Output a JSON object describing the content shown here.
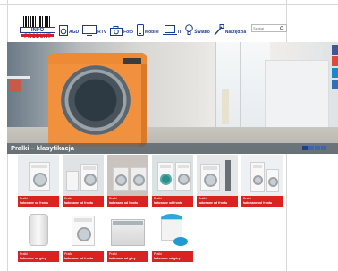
{
  "header": {
    "logo_text": "INFO PRODUKT",
    "nav": [
      {
        "label": "AGD",
        "icon": "washing-machine-icon"
      },
      {
        "label": "RTV",
        "icon": "tv-icon"
      },
      {
        "label": "Foto",
        "icon": "camera-icon"
      },
      {
        "label": "Mobile",
        "icon": "phone-icon"
      },
      {
        "label": "IT",
        "icon": "laptop-icon"
      },
      {
        "label": "Światło",
        "icon": "bulb-icon"
      },
      {
        "label": "Narzędzia",
        "icon": "tools-icon"
      }
    ],
    "search": {
      "placeholder": "Szukaj"
    }
  },
  "hero": {
    "caption": "Pralki – klasyfikacja",
    "slides": 4,
    "active_slide": 1
  },
  "products_row1": [
    {
      "title": "Pralki",
      "subtitle": "ładowane od frontu"
    },
    {
      "title": "Pralki",
      "subtitle": "ładowane od frontu"
    },
    {
      "title": "Pralki",
      "subtitle": "ładowane od frontu"
    },
    {
      "title": "Pralki",
      "subtitle": "ładowane od frontu"
    },
    {
      "title": "Pralki",
      "subtitle": "ładowane od frontu"
    },
    {
      "title": "Pralki",
      "subtitle": "ładowane od frontu"
    }
  ],
  "products_row2": [
    {
      "title": "Pralki",
      "subtitle": "ładowane od góry"
    },
    {
      "title": "Pralki",
      "subtitle": "ładowane od frontu"
    },
    {
      "title": "Pralki",
      "subtitle": "ładowane od góry"
    },
    {
      "title": "Pralki",
      "subtitle": "ładowane od góry"
    }
  ],
  "colors": {
    "brand_blue": "#1a3d8f",
    "accent_red": "#d8231f",
    "caption_bg": "#4b5a64"
  }
}
